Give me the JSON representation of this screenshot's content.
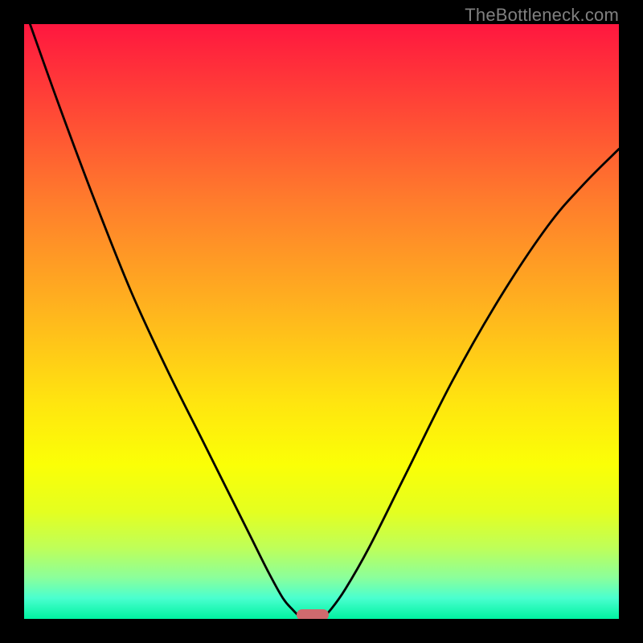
{
  "watermark": "TheBottleneck.com",
  "chart_data": {
    "type": "line",
    "title": "",
    "xlabel": "",
    "ylabel": "",
    "xlim": [
      0,
      100
    ],
    "ylim": [
      0,
      100
    ],
    "grid": false,
    "series": [
      {
        "name": "descending-curve",
        "x": [
          1,
          6,
          12,
          18,
          24,
          30,
          34,
          38,
          41,
          43.5,
          45.2,
          46.2,
          47
        ],
        "y": [
          100,
          86,
          70,
          55,
          42,
          30,
          22,
          14,
          8,
          3.5,
          1.5,
          0.5,
          0
        ]
      },
      {
        "name": "ascending-curve",
        "x": [
          50,
          51.5,
          54,
          58,
          64,
          72,
          80,
          88,
          94,
          100
        ],
        "y": [
          0,
          1.5,
          5,
          12,
          24,
          40,
          54,
          66,
          73,
          79
        ]
      }
    ],
    "marker": {
      "x_center": 48.5,
      "width_pct": 5.4,
      "y": 0
    },
    "background_gradient": {
      "bottom_color": "#00f2a1",
      "top_color": "#ff173f"
    }
  }
}
